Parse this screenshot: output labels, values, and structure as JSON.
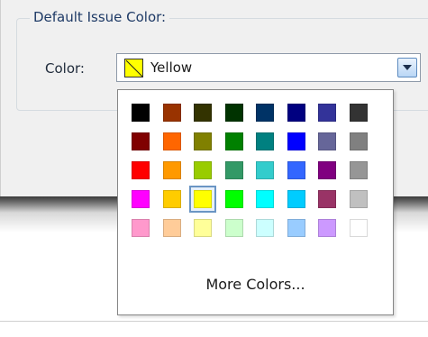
{
  "dialog": {
    "group_title": "Default Issue Color:",
    "color_label": "Color:",
    "selected_color_name": "Yellow",
    "selected_color_hex": "#ffff00"
  },
  "palette": {
    "selected_row": 3,
    "selected_col": 2,
    "rows": [
      [
        "#000000",
        "#993300",
        "#333300",
        "#003300",
        "#003366",
        "#000080",
        "#333399",
        "#333333"
      ],
      [
        "#800000",
        "#ff6600",
        "#808000",
        "#008000",
        "#008080",
        "#0000ff",
        "#666699",
        "#808080"
      ],
      [
        "#ff0000",
        "#ff9900",
        "#99cc00",
        "#339966",
        "#33cccc",
        "#3366ff",
        "#800080",
        "#969696"
      ],
      [
        "#ff00ff",
        "#ffcc00",
        "#ffff00",
        "#00ff00",
        "#00ffff",
        "#00ccff",
        "#993366",
        "#c0c0c0"
      ],
      [
        "#ff99cc",
        "#ffcc99",
        "#ffff99",
        "#ccffcc",
        "#ccffff",
        "#99ccff",
        "#cc99ff",
        "#ffffff"
      ]
    ],
    "more_colors_label": "More Colors..."
  }
}
